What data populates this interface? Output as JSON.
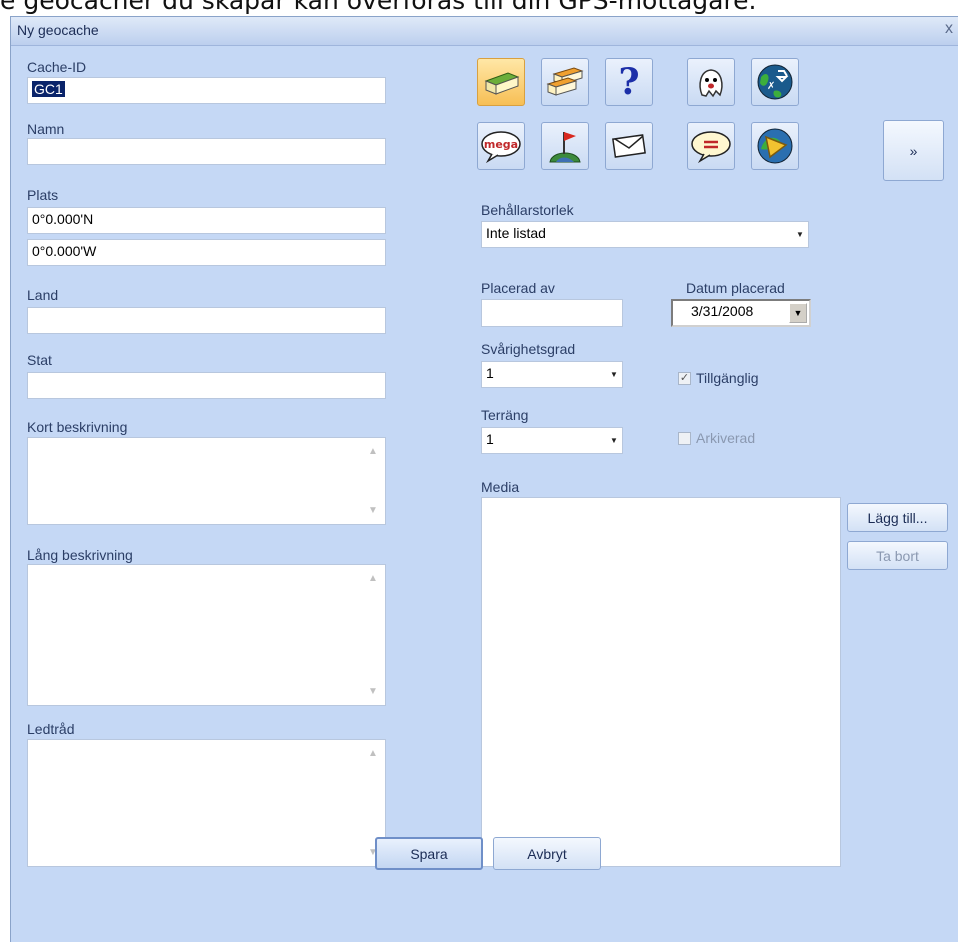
{
  "caption": "e geocacher du skapar kan överföras till din GPS-mottagare.",
  "window": {
    "title": "Ny geocache",
    "close_glyph": "x"
  },
  "left": {
    "cache_id": {
      "label": "Cache-ID",
      "value": "GC1"
    },
    "name": {
      "label": "Namn",
      "value": ""
    },
    "location": {
      "label": "Plats",
      "lat": "0°0.000'N",
      "lon": "0°0.000'W"
    },
    "country": {
      "label": "Land",
      "value": ""
    },
    "state": {
      "label": "Stat",
      "value": ""
    },
    "short_desc": {
      "label": "Kort beskrivning"
    },
    "long_desc": {
      "label": "Lång beskrivning"
    },
    "hint": {
      "label": "Ledtråd"
    }
  },
  "cache_types": [
    {
      "name": "traditional-cache-icon",
      "active": true
    },
    {
      "name": "multi-cache-icon"
    },
    {
      "name": "mystery-cache-icon"
    },
    {
      "name": "ghost-cache-icon"
    },
    {
      "name": "cito-cache-icon"
    },
    {
      "name": "mega-event-icon",
      "text": "mega"
    },
    {
      "name": "earthcache-flag-icon"
    },
    {
      "name": "letterbox-icon"
    },
    {
      "name": "event-speech-icon"
    },
    {
      "name": "wherigo-icon"
    }
  ],
  "more_button": "»",
  "container": {
    "label": "Behållarstorlek",
    "value": "Inte listad"
  },
  "placed_by": {
    "label": "Placerad av",
    "value": ""
  },
  "date_placed": {
    "label": "Datum placerad",
    "value": "3/31/2008"
  },
  "difficulty": {
    "label": "Svårighetsgrad",
    "value": "1"
  },
  "terrain": {
    "label": "Terräng",
    "value": "1"
  },
  "available": {
    "label": "Tillgänglig",
    "checked": true
  },
  "archived": {
    "label": "Arkiverad",
    "checked": false
  },
  "media": {
    "label": "Media",
    "add": "Lägg till...",
    "remove": "Ta bort"
  },
  "buttons": {
    "save": "Spara",
    "cancel": "Avbryt"
  },
  "colors": {
    "dialog_bg": "#c5d8f5",
    "accent": "#0a246a"
  }
}
